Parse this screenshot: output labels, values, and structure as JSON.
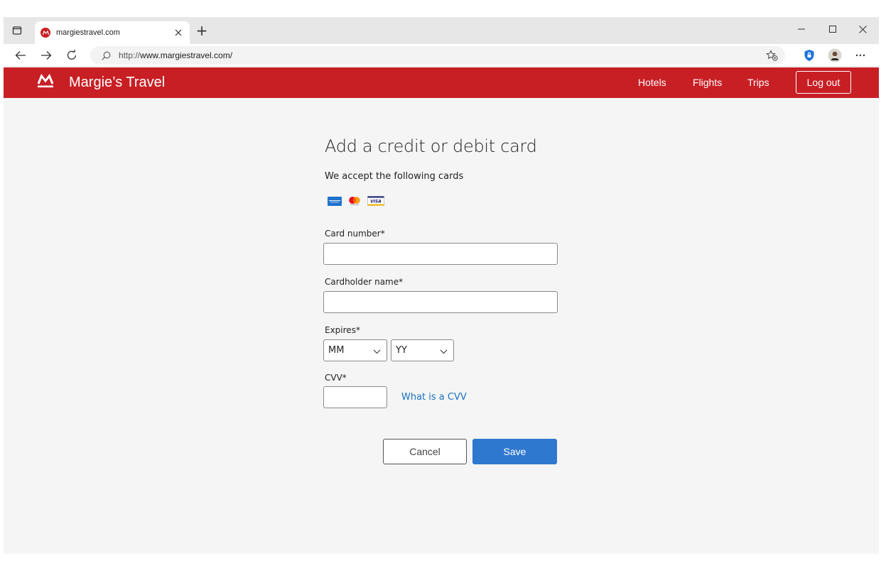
{
  "browser": {
    "tab": {
      "title": "margiestravel.com",
      "favicon": "margies-travel-favicon",
      "close_icon": "close-icon"
    },
    "new_tab_label": "+",
    "url": {
      "scheme": "http://",
      "host": "www.margiestravel.com",
      "path": "/"
    },
    "icons": [
      "tab-actions-icon",
      "back-icon",
      "forward-icon",
      "refresh-icon",
      "search-icon",
      "add-favorite-icon",
      "shield-icon",
      "profile-avatar-icon",
      "more-icon",
      "minimize-icon",
      "maximize-icon",
      "close-window-icon"
    ]
  },
  "site": {
    "brand": "Margie’s Travel",
    "brand_color": "#c81f25",
    "nav": {
      "hotels": "Hotels",
      "flights": "Flights",
      "trips": "Trips"
    },
    "logout": "Log out"
  },
  "form": {
    "title": "Add a credit or debit card",
    "subtitle": "We accept the following cards",
    "accepted_cards": [
      "amex",
      "mastercard",
      "visa"
    ],
    "visa_label": "VISA",
    "card_number_label": "Card number*",
    "card_number_value": "",
    "cardholder_label": "Cardholder name*",
    "cardholder_value": "",
    "expires_label": "Expires*",
    "month_selected": "MM",
    "year_selected": "YY",
    "cvv_label": "CVV*",
    "cvv_value": "",
    "cvv_help": "What is a CVV",
    "cancel": "Cancel",
    "save": "Save",
    "save_color": "#2f78d0",
    "link_color": "#1a6fc2"
  }
}
